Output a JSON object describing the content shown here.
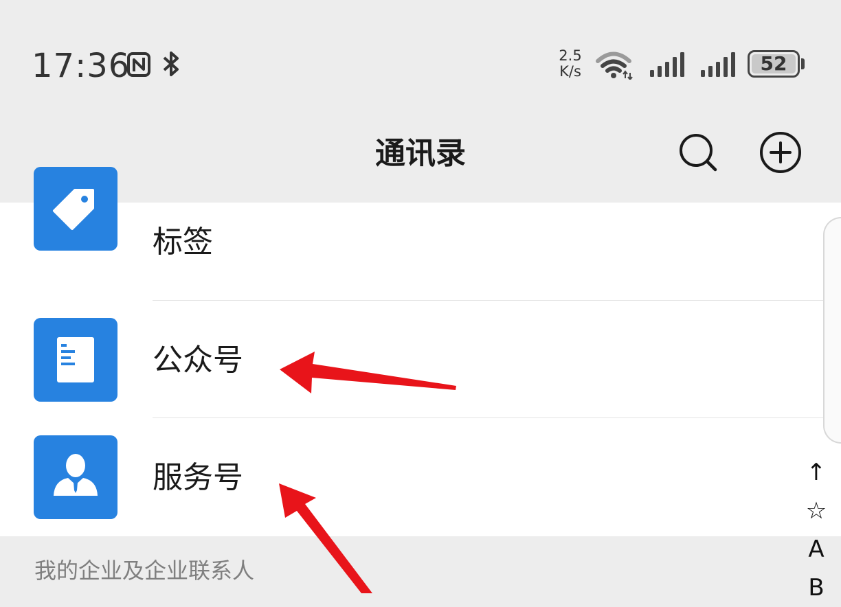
{
  "status_bar": {
    "time": "17:36",
    "speed_value": "2.5",
    "speed_unit": "K/s",
    "battery": "52",
    "icons": [
      "nfc-icon",
      "bluetooth-icon",
      "wifi-icon",
      "cellular-signal-icon",
      "cellular-signal-icon",
      "battery-icon"
    ]
  },
  "header": {
    "title": "通讯录",
    "icons": [
      "search-icon",
      "add-circle-icon"
    ]
  },
  "list": {
    "items": [
      {
        "label": "标签",
        "icon": "tag-icon"
      },
      {
        "label": "公众号",
        "icon": "document-icon"
      },
      {
        "label": "服务号",
        "icon": "person-icon"
      }
    ]
  },
  "section": {
    "label": "我的企业及企业联系人"
  },
  "index_bar": {
    "items": [
      "↑",
      "☆",
      "A",
      "B"
    ]
  },
  "colors": {
    "accent": "#2782e0",
    "annotation": "#e8141a",
    "background": "#ededed"
  }
}
